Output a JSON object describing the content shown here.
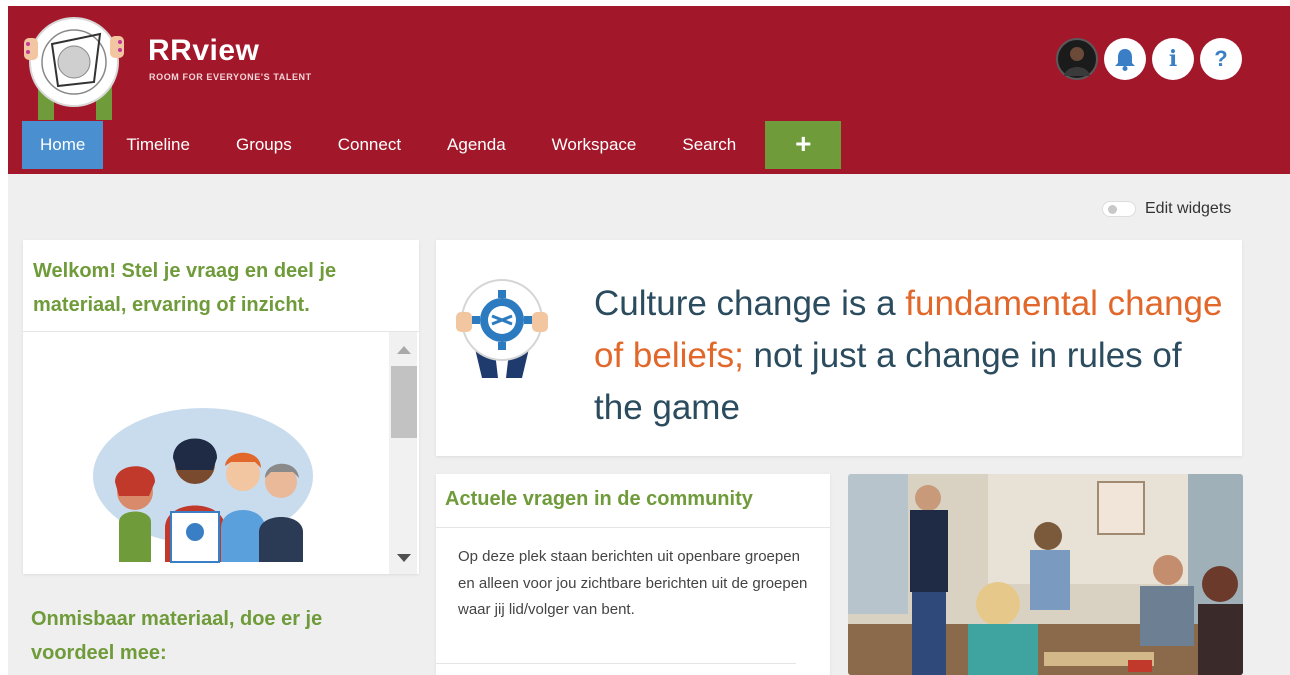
{
  "brand": {
    "name": "RRview",
    "tagline": "ROOM FOR EVERYONE'S TALENT"
  },
  "header_icons": [
    "avatar",
    "bell-icon",
    "info-icon",
    "help-icon"
  ],
  "header_glyphs": {
    "info": "i",
    "help": "?"
  },
  "nav": {
    "items": [
      {
        "label": "Home",
        "active": true
      },
      {
        "label": "Timeline"
      },
      {
        "label": "Groups"
      },
      {
        "label": "Connect"
      },
      {
        "label": "Agenda"
      },
      {
        "label": "Workspace"
      },
      {
        "label": "Search"
      }
    ],
    "plus_label": "+"
  },
  "edit_widgets": {
    "label": "Edit widgets",
    "on": false
  },
  "welcome": {
    "title": "Welkom! Stel je vraag en deel je materiaal, ervaring of inzicht."
  },
  "onmisbaar": {
    "title": "Onmisbaar materiaal, doe er je voordeel mee:"
  },
  "quote": {
    "part1": "Culture change is a ",
    "highlight": "fundamental change of beliefs;",
    "part2": " not just a change in rules of the game"
  },
  "actuele": {
    "title": "Actuele vragen in de community",
    "body": "Op deze plek staan berichten uit openbare groepen en alleen voor jou zichtbare berichten uit de groepen waar jij lid/volger van bent."
  },
  "colors": {
    "header": "#a2182a",
    "nav_active": "#4a8fcf",
    "plus_button": "#6f9b3a",
    "green_title": "#6f9b3a",
    "quote_text": "#2b4b5e",
    "quote_highlight": "#e1672a",
    "background": "#efefef"
  }
}
